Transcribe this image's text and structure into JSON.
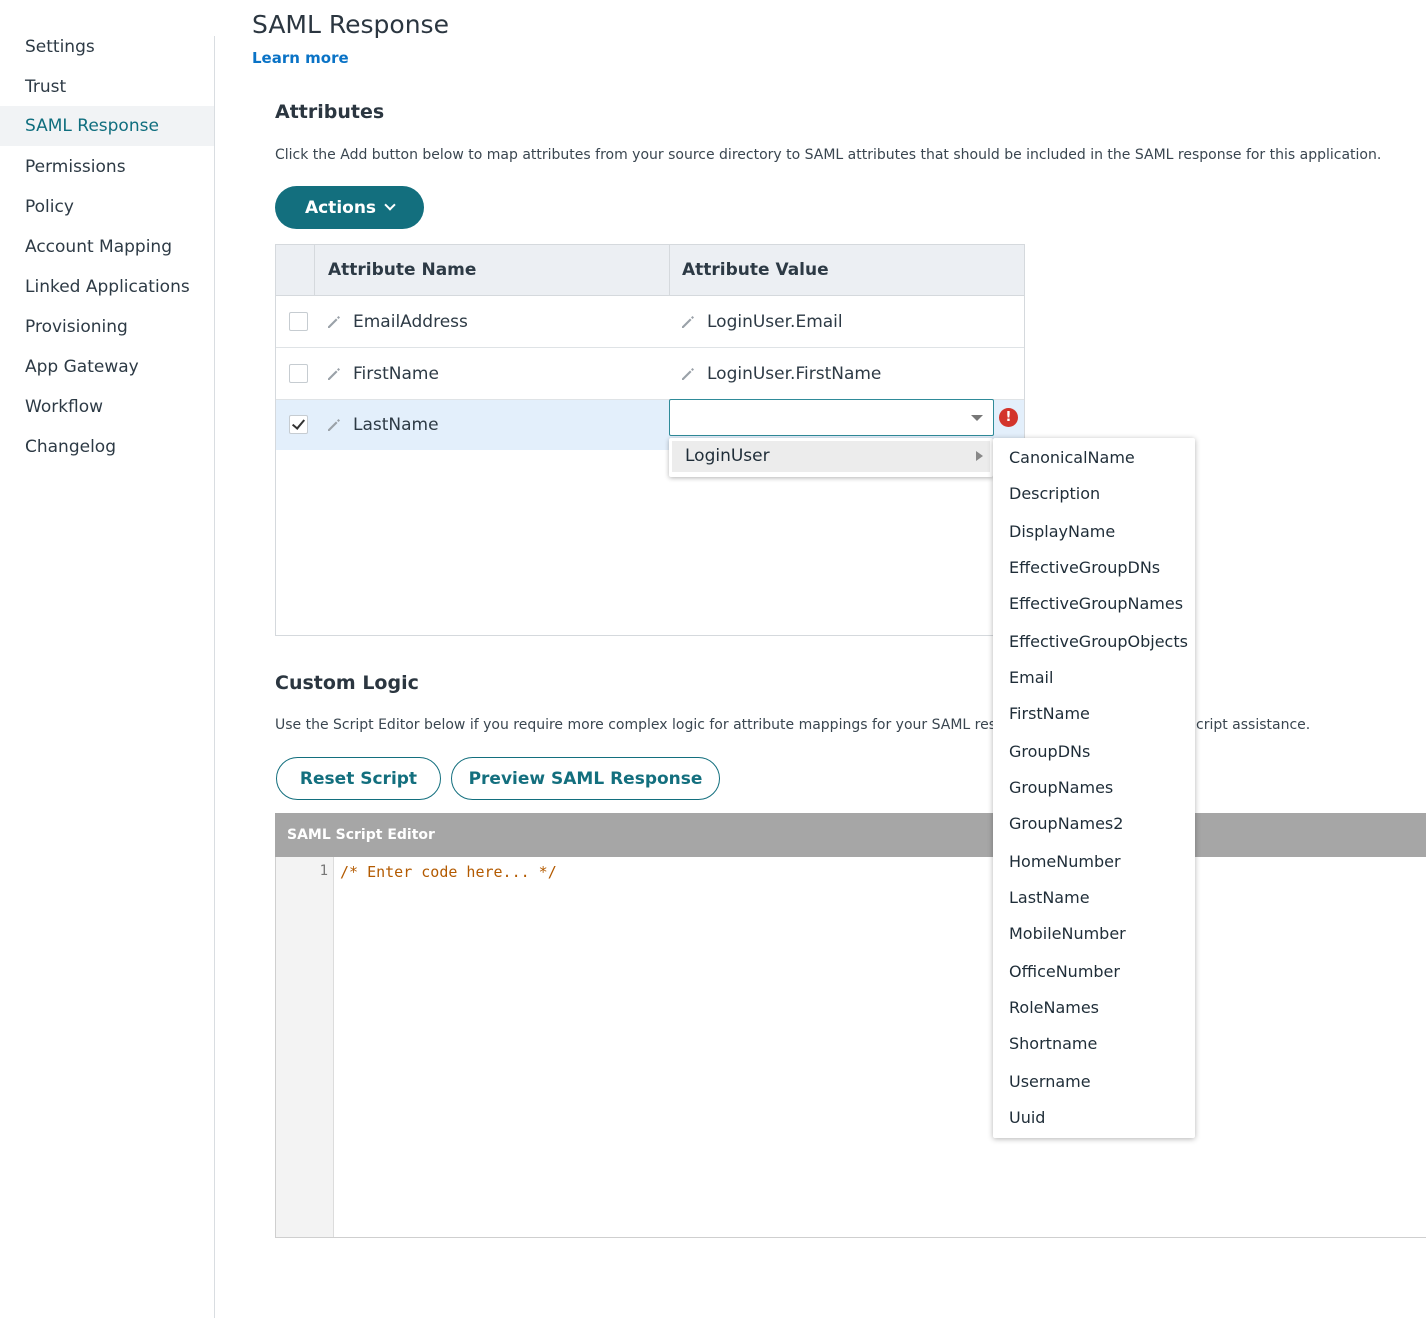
{
  "sidebar": {
    "items": [
      {
        "label": "Settings"
      },
      {
        "label": "Trust"
      },
      {
        "label": "SAML Response",
        "active": true
      },
      {
        "label": "Permissions"
      },
      {
        "label": "Policy"
      },
      {
        "label": "Account Mapping"
      },
      {
        "label": "Linked Applications"
      },
      {
        "label": "Provisioning"
      },
      {
        "label": "App Gateway"
      },
      {
        "label": "Workflow"
      },
      {
        "label": "Changelog"
      }
    ]
  },
  "header": {
    "title": "SAML Response",
    "learn_more": "Learn more"
  },
  "attributes": {
    "title": "Attributes",
    "description": "Click the Add button below to map attributes from your source directory to SAML attributes that should be included in the SAML response for this application.",
    "actions_label": "Actions",
    "columns": [
      "Attribute Name",
      "Attribute Value"
    ],
    "rows": [
      {
        "name": "EmailAddress",
        "value": "LoginUser.Email",
        "checked": false
      },
      {
        "name": "FirstName",
        "value": "LoginUser.FirstName",
        "checked": false
      },
      {
        "name": "LastName",
        "value": "",
        "checked": true
      }
    ],
    "error_icon": "!",
    "dropdown": {
      "category": "LoginUser",
      "options": [
        "CanonicalName",
        "Description",
        "DisplayName",
        "EffectiveGroupDNs",
        "EffectiveGroupNames",
        "EffectiveGroupObjects",
        "Email",
        "FirstName",
        "GroupDNs",
        "GroupNames",
        "GroupNames2",
        "HomeNumber",
        "LastName",
        "MobileNumber",
        "OfficeNumber",
        "RoleNames",
        "Shortname",
        "Username",
        "Uuid"
      ]
    }
  },
  "custom_logic": {
    "title": "Custom Logic",
    "description_left": "Use the Script Editor below if you require more complex logic for attribute mappings for your SAML res",
    "description_right": "cript assistance.",
    "reset_label": "Reset Script",
    "preview_label": "Preview SAML Response"
  },
  "editor": {
    "title": "SAML Script Editor",
    "line_number": "1",
    "code": "/* Enter code here... */"
  },
  "colors": {
    "accent": "#136f7e",
    "link": "#0a73c6",
    "error": "#d3342b"
  }
}
